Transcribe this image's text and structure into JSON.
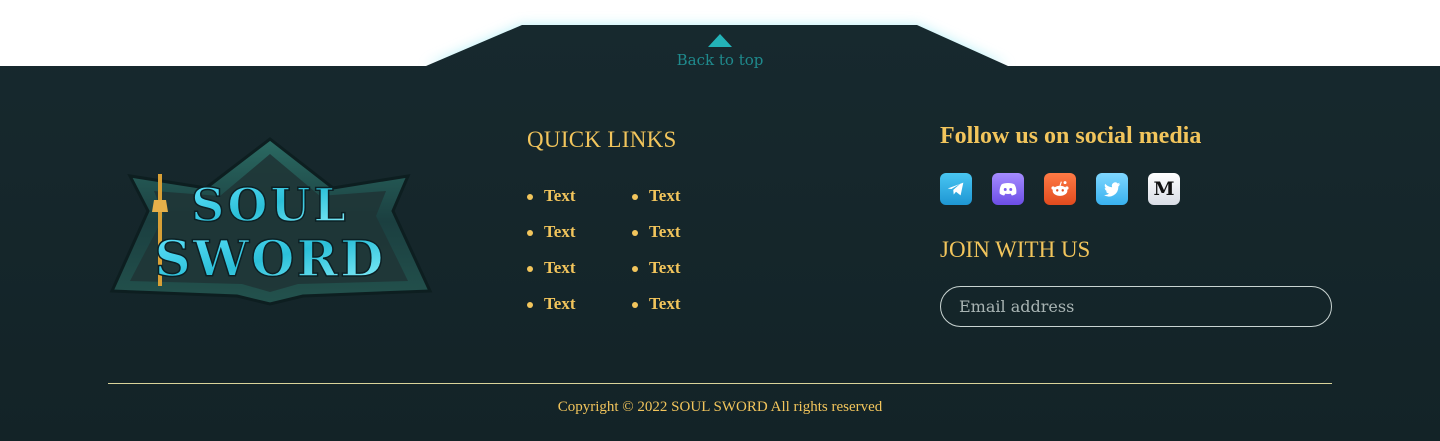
{
  "back_to_top": {
    "label": "Back to top"
  },
  "logo": {
    "line1": "SOUL",
    "line2": "SWORD"
  },
  "quick_links": {
    "title": "QUICK LINKS",
    "column1": [
      "Text",
      "Text",
      "Text",
      "Text"
    ],
    "column2": [
      "Text",
      "Text",
      "Text",
      "Text"
    ]
  },
  "social": {
    "title": "Follow us on social media",
    "icons": [
      "telegram-icon",
      "discord-icon",
      "reddit-icon",
      "twitter-icon",
      "medium-icon"
    ],
    "medium_glyph": "M"
  },
  "join": {
    "title": "JOIN WITH US",
    "email_placeholder": "Email address",
    "email_value": ""
  },
  "copyright": "Copyright © 2022 SOUL SWORD All rights reserved",
  "colors": {
    "background": "#15292e",
    "accent_gold": "#f2c55c",
    "teal": "#23b3b8"
  }
}
